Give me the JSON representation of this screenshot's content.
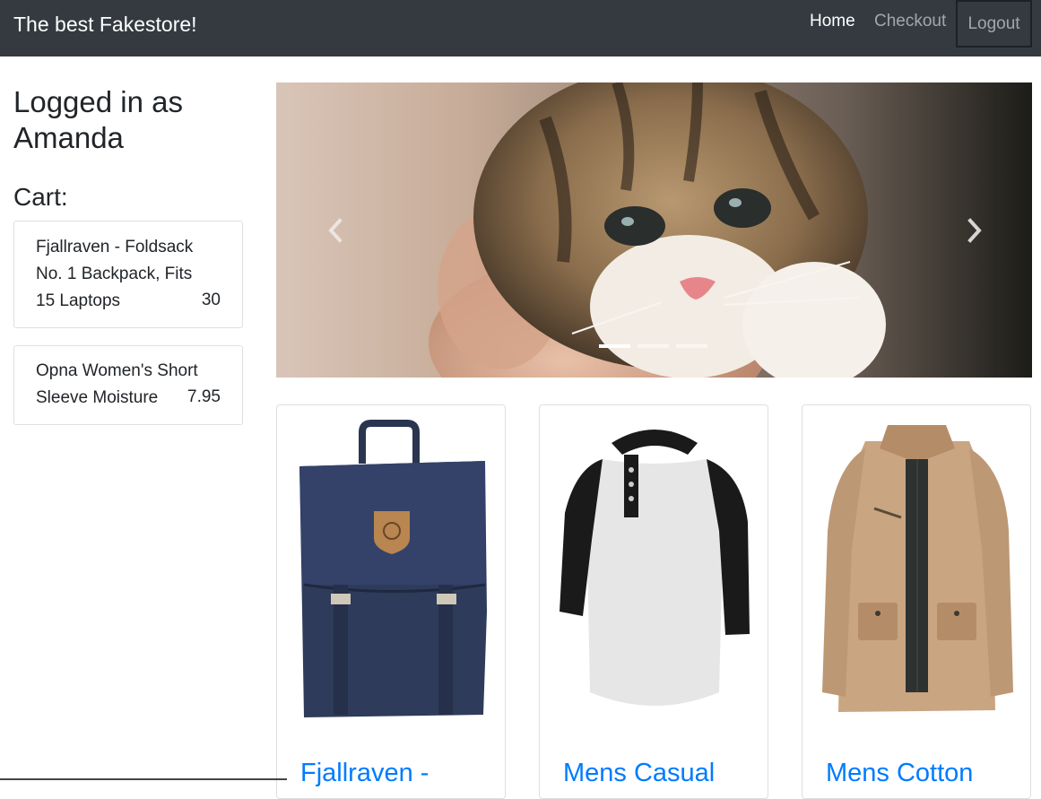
{
  "navbar": {
    "brand": "The best Fakestore!",
    "links": [
      {
        "label": "Home"
      },
      {
        "label": "Checkout"
      }
    ],
    "logout_label": "Logout"
  },
  "sidebar": {
    "title": "Logged in as Amanda",
    "cart_heading": "Cart:",
    "cart_items": [
      {
        "name": "Fjallraven - Foldsack No. 1 Backpack, Fits 15 Laptops",
        "price": "30"
      },
      {
        "name": "Opna Women's Short Sleeve Moisture",
        "price": "7.95"
      }
    ]
  },
  "carousel": {
    "prev_icon": "chevron-left-icon",
    "next_icon": "chevron-right-icon",
    "slide_count": 3,
    "active_index": 0
  },
  "products": [
    {
      "title": "Fjallraven -",
      "image": "navy-backpack"
    },
    {
      "title": "Mens Casual",
      "image": "raglan-henley-shirt"
    },
    {
      "title": "Mens Cotton",
      "image": "khaki-jacket"
    }
  ],
  "colors": {
    "navbar_bg": "#343a40",
    "link_blue": "#007bff"
  }
}
